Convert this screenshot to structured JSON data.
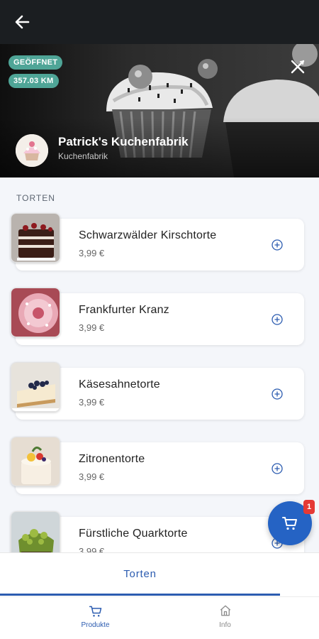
{
  "header": {
    "back_icon": "arrow-left-icon"
  },
  "hero": {
    "status_badge": "GEÖFFNET",
    "distance_badge": "357.03 KM",
    "shop_name": "Patrick's Kuchenfabrik",
    "shop_subtitle": "Kuchenfabrik",
    "close_icon": "cross-icon"
  },
  "section": {
    "title": "TORTEN"
  },
  "products": [
    {
      "name": "Schwarzwälder Kirschtorte",
      "price": "3,99 €"
    },
    {
      "name": "Frankfurter Kranz",
      "price": "3,99 €"
    },
    {
      "name": "Käsesahnetorte",
      "price": "3,99 €"
    },
    {
      "name": "Zitronentorte",
      "price": "3,99 €"
    },
    {
      "name": "Fürstliche Quarktorte",
      "price": "3,99 €"
    }
  ],
  "cart": {
    "count": "1",
    "icon": "cart-icon"
  },
  "category_tabs": {
    "active": "Torten"
  },
  "bottom_nav": {
    "products_label": "Produkte",
    "info_label": "Info"
  },
  "colors": {
    "accent": "#2c5cb0",
    "badge_green": "#4fa597",
    "cart_badge": "#e53935"
  }
}
